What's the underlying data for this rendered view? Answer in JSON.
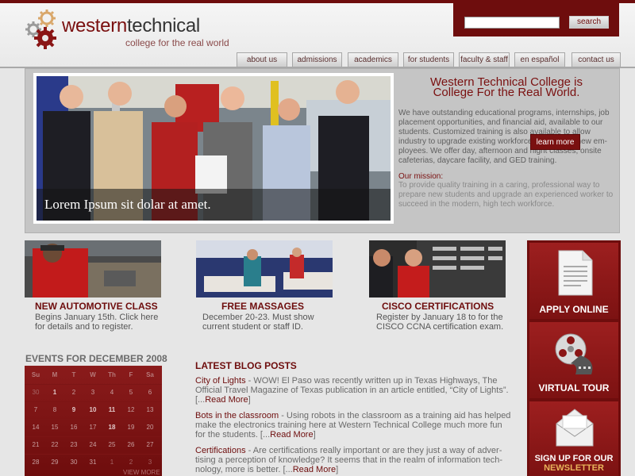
{
  "brand": {
    "name_part1": "western",
    "name_part2": "technical",
    "tagline": "college for the real world"
  },
  "search": {
    "value": "",
    "button_label": "search"
  },
  "nav": {
    "tabs": [
      {
        "label": "about us"
      },
      {
        "label": "admissions"
      },
      {
        "label": "academics"
      },
      {
        "label": "for students"
      },
      {
        "label": "faculty & staff"
      },
      {
        "label": "en español"
      },
      {
        "label": "contact us"
      }
    ]
  },
  "hero": {
    "caption": "Lorem Ipsum sit dolar at amet.",
    "title_line1": "Western Technical College is",
    "title_line2": "College For the Real World.",
    "body": "We have outstanding educational programs, internships, job placement opportunities, and financial aid, available to our students. Customized training is also available to allow industry to upgrade existing workforce and/or train new em-ployees. We offer day, afternoon and night classes, onsite cafeterias, daycare facility, and GED training.",
    "mission_heading": "Our mission:",
    "mission_text": "To provide quality training in a caring, professional way to prepare new students and upgrade an experienced worker to succeed in the modern, high tech workforce.",
    "learn_more_label": "learn more"
  },
  "features": [
    {
      "title": "NEW AUTOMOTIVE CLASS",
      "text": "Begins January 15th. Click here for details and to register."
    },
    {
      "title": "FREE MASSAGES",
      "text": "December 20-23.  Must show current student or staff ID."
    },
    {
      "title": "CISCO CERTIFICATIONS",
      "text": "Register by January 18 to for the CISCO CCNA certification exam."
    }
  ],
  "events": {
    "heading": "EVENTS FOR DECEMBER 2008",
    "days": [
      "Su",
      "M",
      "T",
      "W",
      "Th",
      "F",
      "Sa"
    ],
    "weeks": [
      [
        "30",
        "1",
        "2",
        "3",
        "4",
        "5",
        "6"
      ],
      [
        "7",
        "8",
        "9",
        "10",
        "11",
        "12",
        "13"
      ],
      [
        "14",
        "15",
        "16",
        "17",
        "18",
        "19",
        "20"
      ],
      [
        "21",
        "22",
        "23",
        "24",
        "25",
        "26",
        "27"
      ],
      [
        "28",
        "29",
        "30",
        "31",
        "1",
        "2",
        "3"
      ]
    ],
    "view_more_label": "VIEW MORE"
  },
  "blog": {
    "heading": "LATEST BLOG POSTS",
    "posts": [
      {
        "title": "City of Lights",
        "text": " - WOW! El Paso was recently written up in Texas Highways, The Official Travel Magazine of Texas publication in an article entitled, “City of Lights”. [...",
        "more": "Read More",
        "close": "]"
      },
      {
        "title": "Bots in the classroom",
        "text": " - Using robots in the classroom as a training aid has helped make the electronics training here at Western Technical College much more fun for the students. [...",
        "more": "Read More",
        "close": "]"
      },
      {
        "title": "Certifications",
        "text": " - Are certifications really important or are they just a way of adver-tising a perception of knowledge? It seems that in the realm of information tech-nology, more is better. [...",
        "more": "Read More",
        "close": "]"
      }
    ]
  },
  "sidebar": {
    "apply_label": "APPLY ONLINE",
    "tour_label": "VIRTUAL TOUR",
    "newsletter_line1": "SIGN UP FOR OUR",
    "newsletter_line2": "NEWSLETTER"
  },
  "icons": {
    "logo": "gears-icon",
    "apply": "document-icon",
    "tour": "film-reel-icon",
    "newsletter": "envelope-icon"
  },
  "colors": {
    "brand_red": "#6e0d0d",
    "accent_gold": "#e9b35a",
    "background": "#e6e6e6"
  }
}
